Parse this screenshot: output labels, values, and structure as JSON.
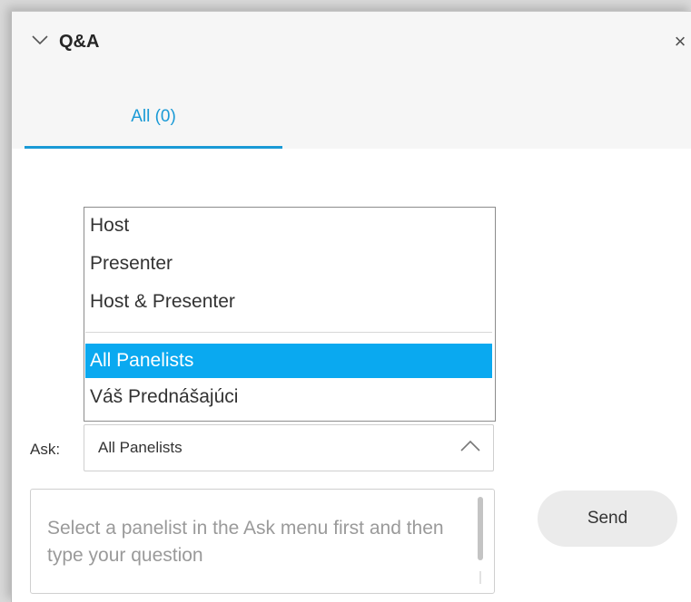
{
  "header": {
    "title": "Q&A",
    "collapse_icon": "chevron-down-icon",
    "close_glyph": "×"
  },
  "tabs": [
    {
      "label": "All (0)",
      "active": true
    }
  ],
  "ask_dropdown": {
    "options": [
      "Host",
      "Presenter",
      "Host & Presenter",
      "All Panelists",
      "Váš Prednášajúci"
    ],
    "selected": "All Panelists"
  },
  "ask": {
    "label": "Ask:",
    "value": "All Panelists"
  },
  "question": {
    "value": "",
    "placeholder": "Select a panelist in the Ask menu first and then type your question"
  },
  "send": {
    "label": "Send"
  },
  "colors": {
    "accent": "#1a9ad6",
    "selected_bg": "#0aa9f0",
    "header_bg": "#f6f6f6"
  }
}
